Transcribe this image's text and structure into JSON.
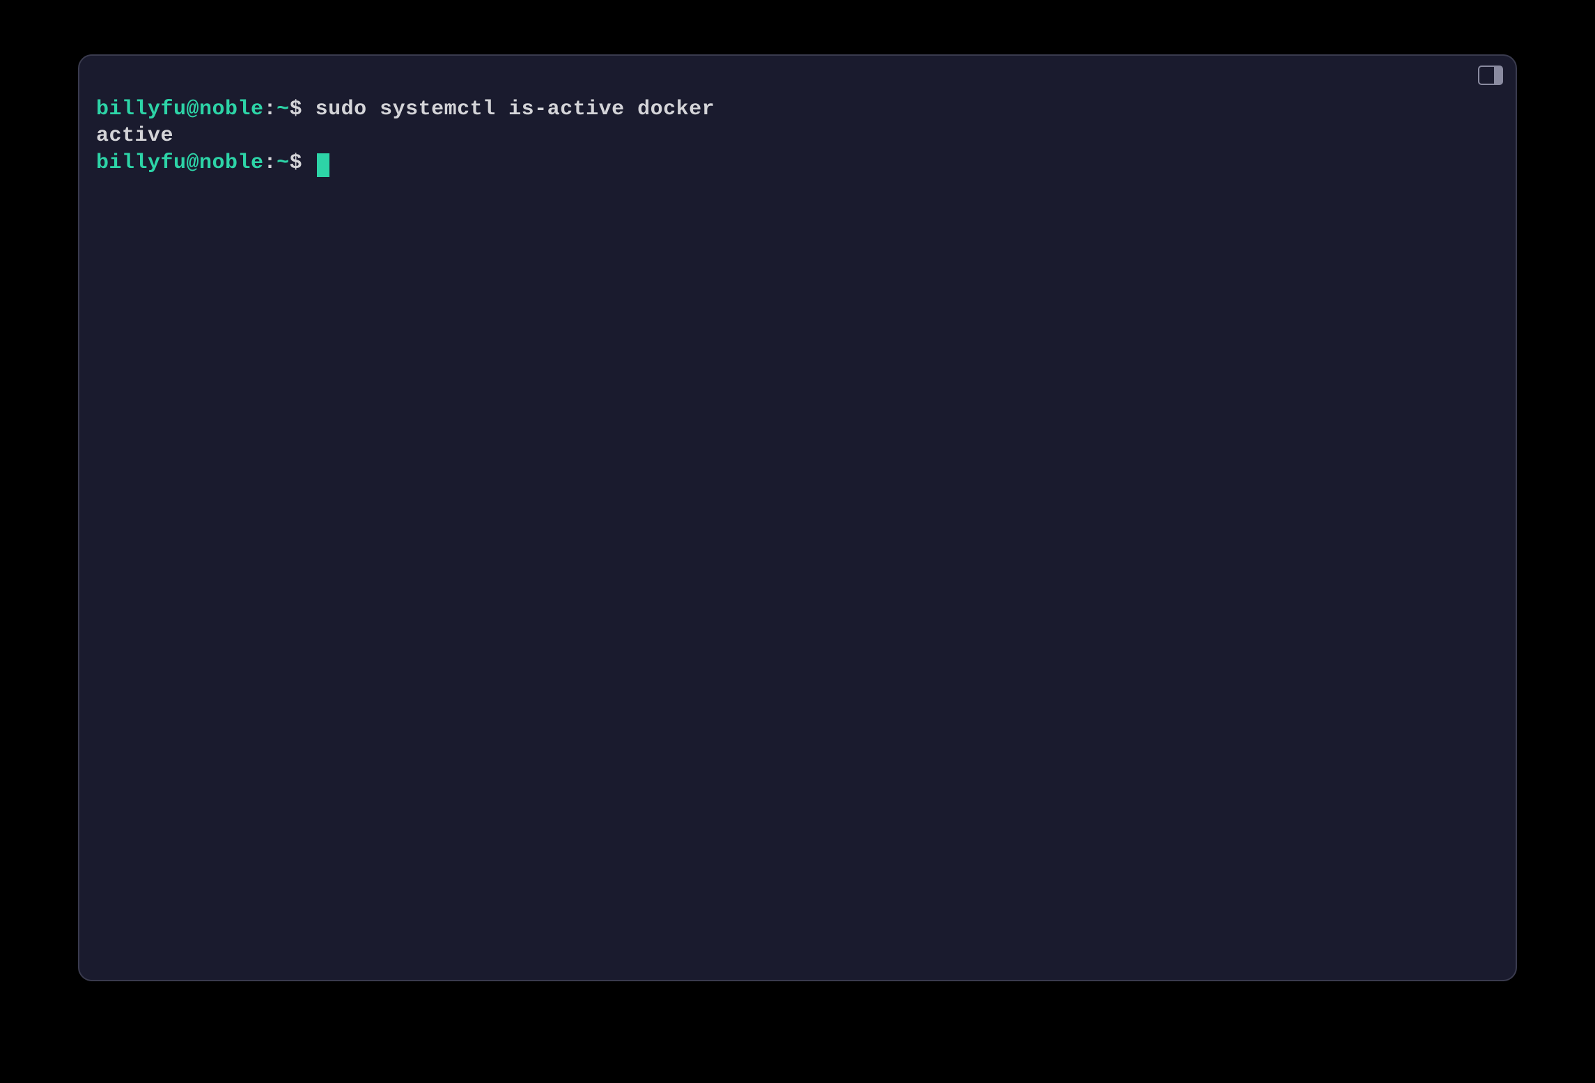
{
  "terminal": {
    "lines": [
      {
        "prompt": {
          "user_host": "billyfu@noble",
          "colon": ":",
          "path": "~",
          "dollar": "$"
        },
        "command": " sudo systemctl is-active docker"
      },
      {
        "output": "active"
      },
      {
        "prompt": {
          "user_host": "billyfu@noble",
          "colon": ":",
          "path": "~",
          "dollar": "$"
        },
        "command": " ",
        "has_cursor": true
      }
    ]
  }
}
